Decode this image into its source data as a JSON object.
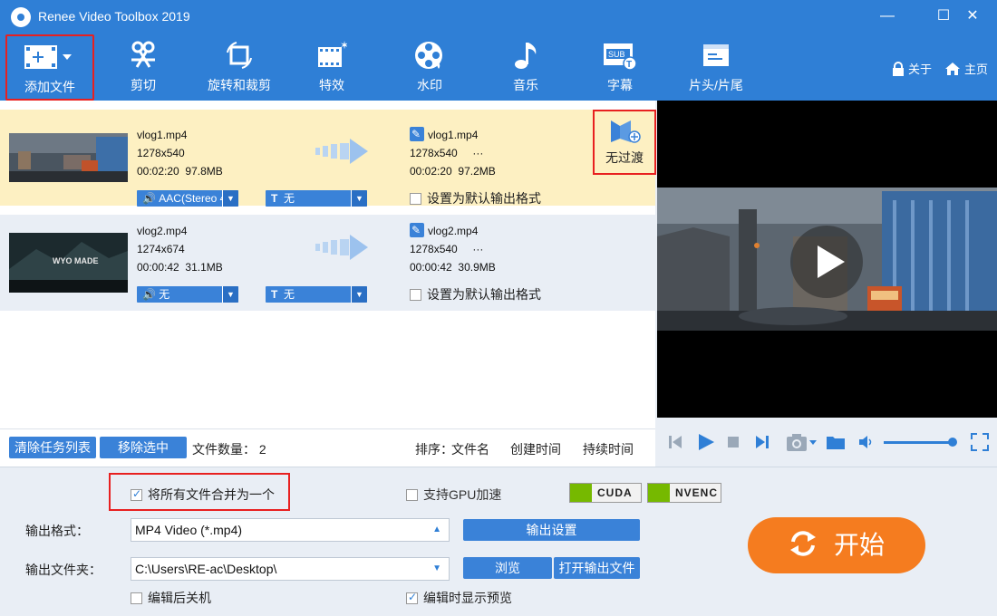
{
  "app": {
    "title": "Renee Video Toolbox 2019"
  },
  "window": {
    "minimize": "—",
    "maximize": "☐",
    "close": "✕"
  },
  "toolbar": {
    "items": [
      {
        "label": "添加文件"
      },
      {
        "label": "剪切"
      },
      {
        "label": "旋转和裁剪"
      },
      {
        "label": "特效"
      },
      {
        "label": "水印"
      },
      {
        "label": "音乐"
      },
      {
        "label": "字幕"
      },
      {
        "label": "片头/片尾"
      }
    ],
    "about": "关于",
    "home": "主页",
    "subtitle_icon_text": "SUB"
  },
  "files": [
    {
      "name": "vlog1.mp4",
      "resolution": "1278x540",
      "duration": "00:02:20",
      "size": "97.8MB",
      "out_name": "vlog1.mp4",
      "out_resolution": "1278x540",
      "out_more": "···",
      "out_duration": "00:02:20",
      "out_size": "97.2MB",
      "audio": "AAC(Stereo 4",
      "subtitle": "无",
      "default_label": "设置为默认输出格式",
      "default_checked": false
    },
    {
      "name": "vlog2.mp4",
      "resolution": "1274x674",
      "duration": "00:00:42",
      "size": "31.1MB",
      "out_name": "vlog2.mp4",
      "out_resolution": "1278x540",
      "out_more": "···",
      "out_duration": "00:00:42",
      "out_size": "30.9MB",
      "audio": "无",
      "subtitle": "无",
      "default_label": "设置为默认输出格式",
      "default_checked": false,
      "thumb_text": "WYO MADE"
    }
  ],
  "transition": {
    "label": "无过渡"
  },
  "listbar": {
    "clear": "清除任务列表",
    "remove": "移除选中",
    "count_label": "文件数量：",
    "count": "2",
    "sort_label": "排序：",
    "sort_options": [
      "文件名",
      "创建时间",
      "持续时间"
    ]
  },
  "player": {
    "volume": 0.95
  },
  "settings": {
    "merge_label": "将所有文件合并为一个",
    "merge_checked": true,
    "gpu_label": "支持GPU加速",
    "gpu_checked": false,
    "badges": [
      "CUDA",
      "NVENC"
    ],
    "format_label": "输出格式：",
    "format_value": "MP4 Video (*.mp4)",
    "output_settings": "输出设置",
    "folder_label": "输出文件夹：",
    "folder_value": "C:\\Users\\RE-ac\\Desktop\\",
    "browse": "浏览",
    "open_folder": "打开输出文件",
    "shutdown_label": "编辑后关机",
    "shutdown_checked": false,
    "preview_label": "编辑时显示预览",
    "preview_checked": true,
    "start": "开始"
  },
  "colors": {
    "accent": "#2f7fd6",
    "start": "#f57c1f",
    "highlight": "#e82020",
    "selected_row": "#fdf0c2"
  }
}
